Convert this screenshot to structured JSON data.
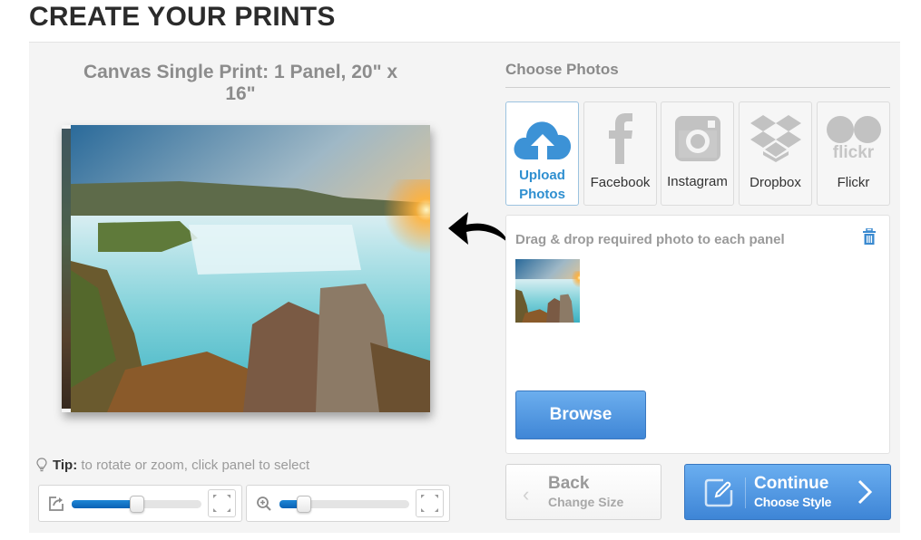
{
  "page": {
    "title": "CREATE YOUR PRINTS"
  },
  "preview": {
    "title": "Canvas Single Print: 1 Panel, 20\" x 16\"",
    "image_description": "Waterfall landscape at sunset (Godafoss-style) with rocks in foreground"
  },
  "tip": {
    "label": "Tip:",
    "text": " to rotate or zoom, click panel to select"
  },
  "controls": {
    "rotate": {
      "icon": "rotate-icon",
      "value_fraction": 0.5
    },
    "zoom": {
      "icon": "zoom-in-icon",
      "value_fraction": 0.19
    },
    "fit_icon": "fit-to-panel-icon"
  },
  "choose_photos": {
    "label": "Choose Photos",
    "sources": [
      {
        "id": "upload",
        "label_line1": "Upload",
        "label_line2": "Photos",
        "icon": "cloud-upload-icon",
        "active": true,
        "color": "#2f8fd0"
      },
      {
        "id": "facebook",
        "label": "Facebook",
        "icon": "facebook-icon",
        "active": false
      },
      {
        "id": "instagram",
        "label": "Instagram",
        "icon": "instagram-icon",
        "active": false
      },
      {
        "id": "dropbox",
        "label": "Dropbox",
        "icon": "dropbox-icon",
        "active": false
      },
      {
        "id": "flickr",
        "label": "Flickr",
        "icon": "flickr-icon",
        "icon_text": "flickr",
        "active": false
      }
    ]
  },
  "drop_area": {
    "instruction": "Drag & drop required photo to each panel",
    "browse_label": "Browse"
  },
  "nav": {
    "back": {
      "title": "Back",
      "subtitle": "Change Size"
    },
    "continue": {
      "title": "Continue",
      "subtitle": "Choose Style"
    }
  },
  "colors": {
    "accent": "#3f86d6",
    "slider_fill": "#0a62b4",
    "panel_bg": "#f4f4f4"
  }
}
